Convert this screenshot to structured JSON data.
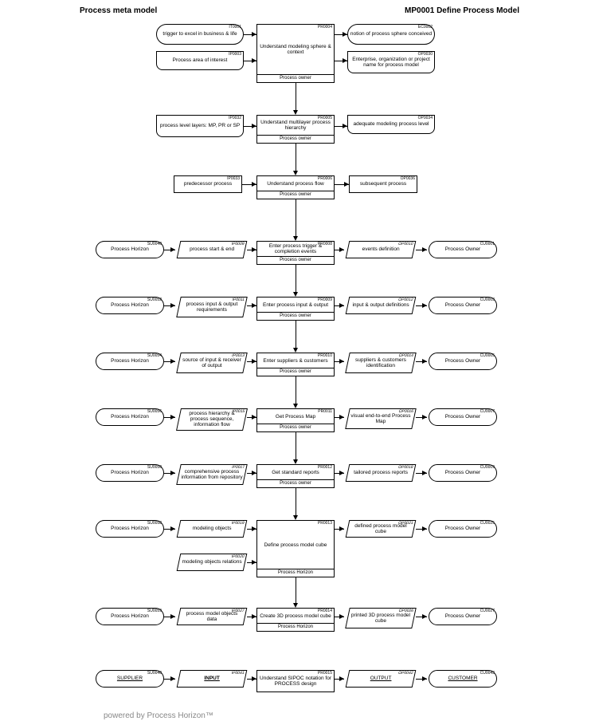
{
  "title_left": "Process meta model",
  "title_right": "MP0001 Define Process Model",
  "footer": "powered by Process Horizon™",
  "ids": {
    "IT0001": "IT0001",
    "EC0002": "EC0002",
    "PR0004": "PR0004",
    "IP0003": "IP0003",
    "OP0030": "OP0030",
    "IP0032": "IP0032",
    "PR0005": "PR0005",
    "OP0034": "OP0034",
    "IP0033": "IP0033",
    "PR0006": "PR0006",
    "OP0036": "OP0036",
    "SU0040": "SU0040",
    "IP0009": "IP0009",
    "PR0008": "PR0008",
    "OP0010": "OP0010",
    "CU0001": "CU0001",
    "SU0052": "SU0052",
    "IP0011": "IP0011",
    "PR0009": "PR0009",
    "OP0012": "OP0012",
    "CU0003": "CU0003",
    "SU0054": "SU0054",
    "IP0013": "IP0013",
    "PR0010": "PR0010",
    "OP0014": "OP0014",
    "CU0005": "CU0005",
    "SU0056": "SU0056",
    "IP0015": "IP0015",
    "PR0011": "PR0011",
    "OP0016": "OP0016",
    "CU0007": "CU0007",
    "SU0050": "SU0050",
    "IP0017": "IP0017",
    "PR0012": "PR0012",
    "OP0018": "OP0018",
    "CU0009": "CU0009",
    "SU0058": "SU0058",
    "IP0019": "IP0019",
    "PR0013": "PR0013",
    "OP0021": "OP0021",
    "CU0025": "CU0025",
    "IP0020": "IP0020",
    "SU0059": "SU0059",
    "IP0027": "IP0027",
    "PR0014": "PR0014",
    "OP0026": "OP0026",
    "CU0027": "CU0027",
    "SU0040b": "SU0040",
    "IP0041": "IP0041",
    "PR0015": "PR0015",
    "OP0042": "OP0042",
    "CU0043": "CU0043"
  },
  "r1": {
    "trigger": "trigger to excel in business & life",
    "notion": "notion of process sphere conceived",
    "proc": "Understand modeling sphere & context",
    "owner": "Process owner",
    "interest": "Process area of interest",
    "enterprise": "Enterprise, organization or project name for process model"
  },
  "r2": {
    "in": "process level layers: MP, PR or SP",
    "proc": "Understand multilayer process hierarchy",
    "owner": "Process owner",
    "out": "adequate modeling process level"
  },
  "r3": {
    "in": "predecessor process",
    "proc": "Understand process flow",
    "owner": "Process owner",
    "out": "subsequent process"
  },
  "r4": {
    "sup": "Process Horizon",
    "in": "process start & end",
    "proc": "Enter process trigger & completion events",
    "owner": "Process owner",
    "out": "events definition",
    "cust": "Process Owner"
  },
  "r5": {
    "sup": "Process Horizon",
    "in": "process input & output requirements",
    "proc": "Enter process input & output",
    "owner": "Process owner",
    "out": "input & output definitions",
    "cust": "Process Owner"
  },
  "r6": {
    "sup": "Process Horizon",
    "in": "source of input & receiver of output",
    "proc": "Enter suppliers & customers",
    "owner": "Process owner",
    "out": "suppliers & customers identification",
    "cust": "Process Owner"
  },
  "r7": {
    "sup": "Process Horizon",
    "in": "process hierarchy & process sequence, information flow",
    "proc": "Get Process Map",
    "owner": "Process owner",
    "out": "visual end-to-end Process Map",
    "cust": "Process Owner"
  },
  "r8": {
    "sup": "Process Horizon",
    "in": "comprehensive process information from repository",
    "proc": "Get standard reports",
    "owner": "Process owner",
    "out": "tailored process reports",
    "cust": "Process Owner"
  },
  "r9": {
    "sup": "Process Horizon",
    "in1": "modeling objects",
    "in2": "modeling objects relations",
    "proc": "Define process model cube",
    "owner": "Process Horizon",
    "out": "defined process model cube",
    "cust": "Process Owner"
  },
  "r10": {
    "sup": "Process Horizon",
    "in": "process model objects data",
    "proc": "Create 3D process model cube",
    "owner": "Process Horizon",
    "out": "printed 3D process model cube",
    "cust": "Process Owner"
  },
  "r11": {
    "sup": "SUPPLIER",
    "in": "INPUT",
    "proc": "Understand SIPOC notation for PROCESS design",
    "out": "OUTPUT",
    "cust": "CUSTOMER"
  }
}
